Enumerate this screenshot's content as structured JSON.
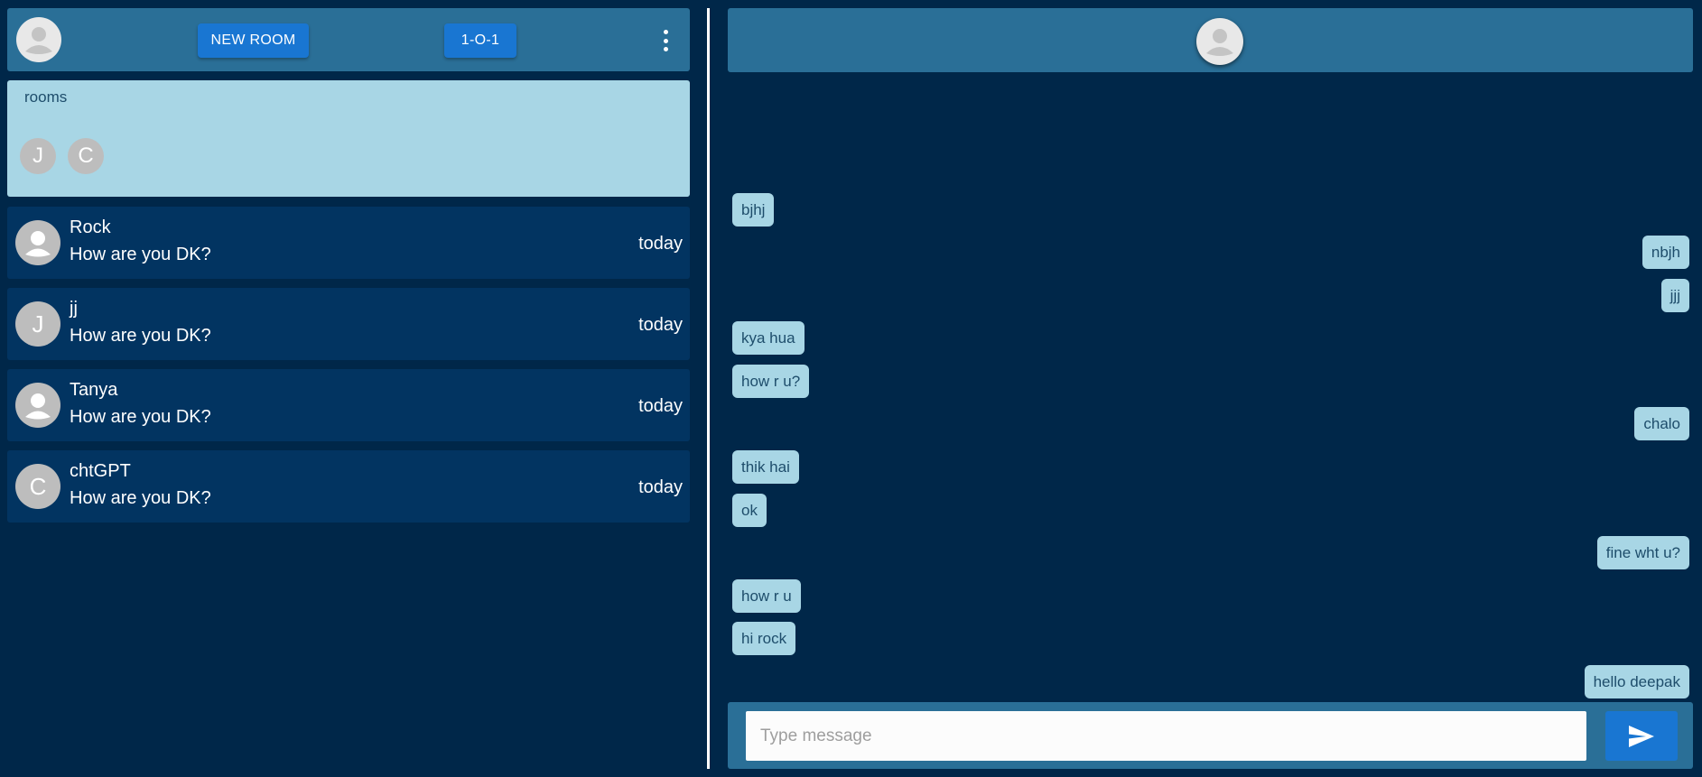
{
  "topbar": {
    "new_room_label": "NEW ROOM",
    "one_on_one_label": "1-O-1"
  },
  "rooms": {
    "label": "rooms",
    "chips": [
      "J",
      "C"
    ]
  },
  "chats": [
    {
      "name": "Rock",
      "avatar": "person-icon",
      "preview": "How are you DK?",
      "time": "today"
    },
    {
      "name": "jj",
      "avatar": "J",
      "preview": "How are you DK?",
      "time": "today"
    },
    {
      "name": "Tanya",
      "avatar": "person-icon",
      "preview": "How are you DK?",
      "time": "today"
    },
    {
      "name": "chtGPT",
      "avatar": "C",
      "preview": "How are you DK?",
      "time": "today"
    }
  ],
  "messages": [
    {
      "text": "bjhj",
      "direction": "incoming"
    },
    {
      "text": "nbjh",
      "direction": "outgoing"
    },
    {
      "text": "jjj",
      "direction": "outgoing"
    },
    {
      "text": "kya hua",
      "direction": "incoming"
    },
    {
      "text": "how r u?",
      "direction": "incoming"
    },
    {
      "text": "chalo",
      "direction": "outgoing"
    },
    {
      "text": "thik hai",
      "direction": "incoming"
    },
    {
      "text": "ok",
      "direction": "incoming"
    },
    {
      "text": "fine wht u?",
      "direction": "outgoing"
    },
    {
      "text": "how r u",
      "direction": "incoming"
    },
    {
      "text": "hi rock",
      "direction": "incoming"
    },
    {
      "text": "hello deepak",
      "direction": "outgoing"
    }
  ],
  "composer": {
    "placeholder": "Type message",
    "value": ""
  },
  "colors": {
    "background": "#002749",
    "panel": "#2a6f97",
    "list_item": "#023461",
    "bubble": "#a8d6e5",
    "accent": "#1976d2"
  }
}
